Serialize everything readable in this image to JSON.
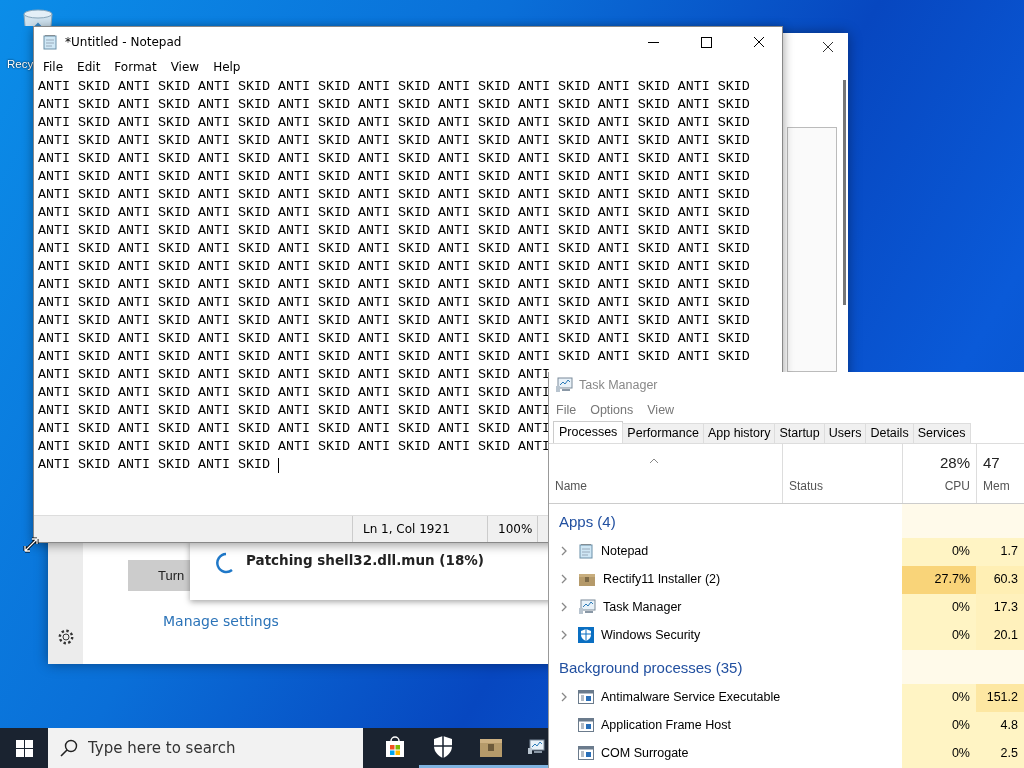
{
  "desktop_icons": [
    {
      "label": "Recy"
    }
  ],
  "back_window": {
    "button": "Turn",
    "link": "Manage settings"
  },
  "progress_dialog": {
    "text": "Patching shell32.dll.mun (18%)"
  },
  "notepad": {
    "title": "*Untitled - Notepad",
    "menu": [
      "File",
      "Edit",
      "Format",
      "View",
      "Help"
    ],
    "lines": [
      "ANTI SKID ANTI SKID ANTI SKID ANTI SKID ANTI SKID ANTI SKID ANTI SKID ANTI SKID ANTI SKID",
      "ANTI SKID ANTI SKID ANTI SKID ANTI SKID ANTI SKID ANTI SKID ANTI SKID ANTI SKID ANTI SKID",
      "ANTI SKID ANTI SKID ANTI SKID ANTI SKID ANTI SKID ANTI SKID ANTI SKID ANTI SKID ANTI SKID",
      "ANTI SKID ANTI SKID ANTI SKID ANTI SKID ANTI SKID ANTI SKID ANTI SKID ANTI SKID ANTI SKID",
      "ANTI SKID ANTI SKID ANTI SKID ANTI SKID ANTI SKID ANTI SKID ANTI SKID ANTI SKID ANTI SKID",
      "ANTI SKID ANTI SKID ANTI SKID ANTI SKID ANTI SKID ANTI SKID ANTI SKID ANTI SKID ANTI SKID",
      "ANTI SKID ANTI SKID ANTI SKID ANTI SKID ANTI SKID ANTI SKID ANTI SKID ANTI SKID ANTI SKID",
      "ANTI SKID ANTI SKID ANTI SKID ANTI SKID ANTI SKID ANTI SKID ANTI SKID ANTI SKID ANTI SKID",
      "ANTI SKID ANTI SKID ANTI SKID ANTI SKID ANTI SKID ANTI SKID ANTI SKID ANTI SKID ANTI SKID",
      "ANTI SKID ANTI SKID ANTI SKID ANTI SKID ANTI SKID ANTI SKID ANTI SKID ANTI SKID ANTI SKID",
      "ANTI SKID ANTI SKID ANTI SKID ANTI SKID ANTI SKID ANTI SKID ANTI SKID ANTI SKID ANTI SKID",
      "ANTI SKID ANTI SKID ANTI SKID ANTI SKID ANTI SKID ANTI SKID ANTI SKID ANTI SKID ANTI SKID",
      "ANTI SKID ANTI SKID ANTI SKID ANTI SKID ANTI SKID ANTI SKID ANTI SKID ANTI SKID ANTI SKID",
      "ANTI SKID ANTI SKID ANTI SKID ANTI SKID ANTI SKID ANTI SKID ANTI SKID ANTI SKID ANTI SKID",
      "ANTI SKID ANTI SKID ANTI SKID ANTI SKID ANTI SKID ANTI SKID ANTI SKID ANTI SKID ANTI SKID",
      "ANTI SKID ANTI SKID ANTI SKID ANTI SKID ANTI SKID ANTI SKID ANTI SKID ANTI SKID ANTI SKID",
      "ANTI SKID ANTI SKID ANTI SKID ANTI SKID ANTI SKID ANTI SKID ANTI",
      "ANTI SKID ANTI SKID ANTI SKID ANTI SKID ANTI SKID ANTI SKID ANTI",
      "ANTI SKID ANTI SKID ANTI SKID ANTI SKID ANTI SKID ANTI SKID ANTI",
      "ANTI SKID ANTI SKID ANTI SKID ANTI SKID ANTI SKID ANTI SKID ANTI",
      "ANTI SKID ANTI SKID ANTI SKID ANTI SKID ANTI SKID ANTI SKID ANTI",
      "ANTI SKID ANTI SKID ANTI SKID"
    ],
    "status": {
      "position": "Ln 1, Col 1921",
      "zoom": "100%"
    }
  },
  "task_manager": {
    "title": "Task Manager",
    "menu": [
      "File",
      "Options",
      "View"
    ],
    "tabs": [
      {
        "label": "Processes",
        "selected": true
      },
      {
        "label": "Performance",
        "selected": false
      },
      {
        "label": "App history",
        "selected": false
      },
      {
        "label": "Startup",
        "selected": false
      },
      {
        "label": "Users",
        "selected": false
      },
      {
        "label": "Details",
        "selected": false
      },
      {
        "label": "Services",
        "selected": false
      }
    ],
    "columns": {
      "name": "Name",
      "status": "Status",
      "cpu_total": "28%",
      "cpu": "CPU",
      "mem_total": "47",
      "mem": "Mem"
    },
    "groups": [
      {
        "title": "Apps (4)",
        "rows": [
          {
            "name": "Notepad",
            "kind": "notepad",
            "expandable": true,
            "cpu": {
              "text": "0%",
              "color": "#fff4c4"
            },
            "mem": {
              "text": "1.7",
              "color": "#fff4c4"
            }
          },
          {
            "name": "Rectify11 Installer (2)",
            "kind": "package",
            "expandable": true,
            "cpu": {
              "text": "27.7%",
              "color": "#f9d479"
            },
            "mem": {
              "text": "60.3",
              "color": "#ffefb4"
            }
          },
          {
            "name": "Task Manager",
            "kind": "taskmgr",
            "expandable": true,
            "cpu": {
              "text": "0%",
              "color": "#fff4c4"
            },
            "mem": {
              "text": "17.3",
              "color": "#fff1bc"
            }
          },
          {
            "name": "Windows Security",
            "kind": "shield",
            "expandable": true,
            "cpu": {
              "text": "0%",
              "color": "#fff4c4"
            },
            "mem": {
              "text": "20.1",
              "color": "#fff1bc"
            }
          }
        ]
      },
      {
        "title": "Background processes (35)",
        "rows": [
          {
            "name": "Antimalware Service Executable",
            "kind": "service",
            "expandable": true,
            "cpu": {
              "text": "0%",
              "color": "#fff4c4"
            },
            "mem": {
              "text": "151.2",
              "color": "#fde7a2"
            }
          },
          {
            "name": "Application Frame Host",
            "kind": "service",
            "expandable": false,
            "cpu": {
              "text": "0%",
              "color": "#fff4c4"
            },
            "mem": {
              "text": "4.8",
              "color": "#fff4c4"
            }
          },
          {
            "name": "COM Surrogate",
            "kind": "service",
            "expandable": false,
            "cpu": {
              "text": "0%",
              "color": "#fff4c4"
            },
            "mem": {
              "text": "2.5",
              "color": "#fff4c4"
            }
          }
        ]
      }
    ]
  },
  "taskbar": {
    "search_placeholder": "Type here to search",
    "apps": [
      {
        "kind": "store",
        "running": false
      },
      {
        "kind": "shield",
        "running": true
      },
      {
        "kind": "package",
        "running": true
      },
      {
        "kind": "taskmgr",
        "running": true
      }
    ]
  }
}
